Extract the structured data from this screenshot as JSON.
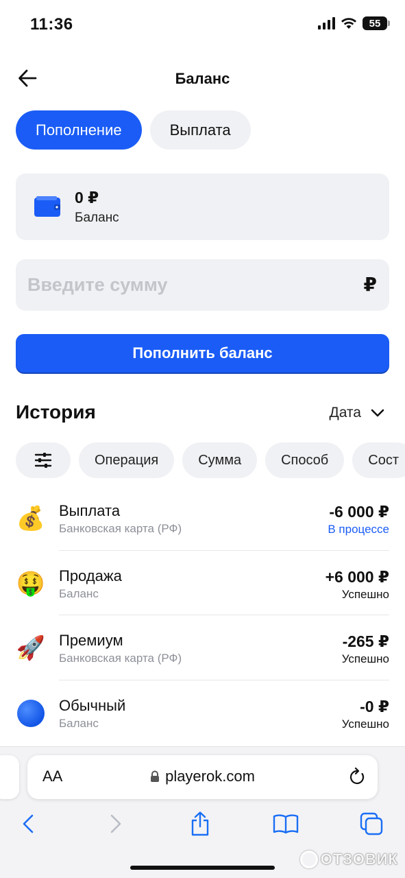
{
  "status_bar": {
    "time": "11:36",
    "battery": "55"
  },
  "header": {
    "title": "Баланс"
  },
  "tabs": [
    {
      "label": "Пополнение",
      "active": true
    },
    {
      "label": "Выплата",
      "active": false
    }
  ],
  "balance": {
    "amount": "0 ₽",
    "label": "Баланс"
  },
  "amount_input": {
    "placeholder": "Введите сумму",
    "currency": "₽",
    "value": ""
  },
  "topup_button": {
    "label": "Пополнить баланс"
  },
  "history": {
    "title": "История",
    "sort_label": "Дата",
    "filters": [
      "Операция",
      "Сумма",
      "Способ",
      "Сост"
    ],
    "transactions": [
      {
        "emoji": "💰",
        "icon": "money-bag-icon",
        "title": "Выплата",
        "method": "Банковская карта (РФ)",
        "amount": "-6 000 ₽",
        "status": "В процессе",
        "status_color": "#1a5cf5"
      },
      {
        "emoji": "🤑",
        "icon": "money-face-icon",
        "title": "Продажа",
        "method": "Баланс",
        "amount": "+6 000 ₽",
        "status": "Успешно",
        "status_color": "#111111"
      },
      {
        "emoji": "🚀",
        "icon": "rocket-icon",
        "title": "Премиум",
        "method": "Банковская карта (РФ)",
        "amount": "-265 ₽",
        "status": "Успешно",
        "status_color": "#111111"
      },
      {
        "emoji": "",
        "icon": "blue-circle-icon",
        "title": "Обычный",
        "method": "Баланс",
        "amount": "-0 ₽",
        "status": "Успешно",
        "status_color": "#111111"
      }
    ]
  },
  "browser": {
    "aa_label": "AA",
    "url": "playerok.com"
  },
  "watermark": "ОТЗОВИК",
  "colors": {
    "accent": "#1a5cf5",
    "chip_bg": "#f0f1f4",
    "muted_text": "#8d9098"
  }
}
